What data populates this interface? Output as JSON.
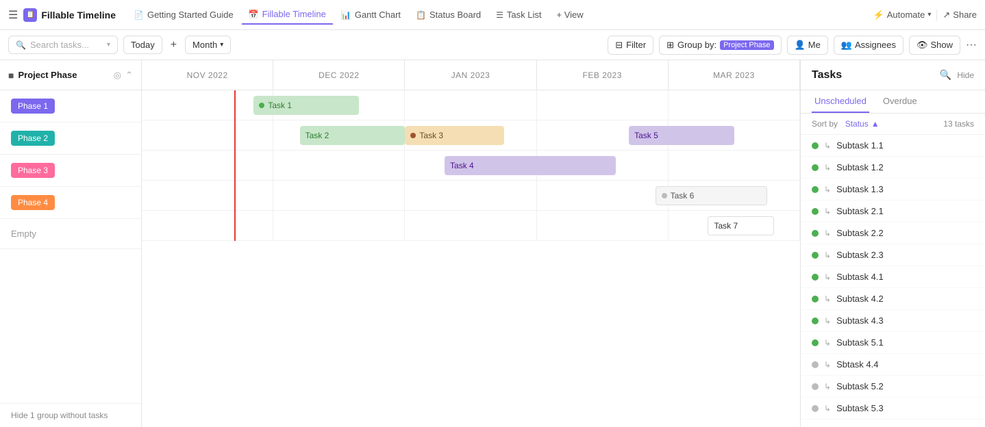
{
  "app": {
    "title": "Fillable Timeline",
    "icon": "📋"
  },
  "nav": {
    "tabs": [
      {
        "id": "getting-started",
        "label": "Getting Started Guide",
        "icon": "📄",
        "active": false
      },
      {
        "id": "fillable-timeline",
        "label": "Fillable Timeline",
        "icon": "📅",
        "active": true
      },
      {
        "id": "gantt-chart",
        "label": "Gantt Chart",
        "icon": "📊",
        "active": false
      },
      {
        "id": "status-board",
        "label": "Status Board",
        "icon": "📋",
        "active": false
      },
      {
        "id": "task-list",
        "label": "Task List",
        "icon": "☰",
        "active": false
      },
      {
        "id": "view",
        "label": "+ View",
        "active": false
      }
    ],
    "automate": "Automate",
    "share": "Share"
  },
  "toolbar": {
    "search_placeholder": "Search tasks...",
    "today": "Today",
    "plus": "+",
    "month": "Month",
    "filter": "Filter",
    "group_by": "Group by:",
    "group_by_tag": "Project Phase",
    "me": "Me",
    "assignees": "Assignees",
    "show": "Show"
  },
  "groups_panel": {
    "title": "Project Phase",
    "phases": [
      {
        "id": "phase1",
        "label": "Phase 1",
        "color": "#7b68ee"
      },
      {
        "id": "phase2",
        "label": "Phase 2",
        "color": "#20b2aa"
      },
      {
        "id": "phase3",
        "label": "Phase 3",
        "color": "#e94f8b"
      },
      {
        "id": "phase4",
        "label": "Phase 4",
        "color": "#ff8c42"
      }
    ],
    "empty_label": "Empty",
    "hide_footer": "Hide 1 group without tasks"
  },
  "timeline": {
    "months": [
      {
        "id": "nov2022",
        "label": "NOV 2022"
      },
      {
        "id": "dec2022",
        "label": "DEC 2022"
      },
      {
        "id": "jan2023",
        "label": "JAN 2023"
      },
      {
        "id": "feb2023",
        "label": "FEB 2023"
      },
      {
        "id": "mar2023",
        "label": "MAR 2023"
      }
    ],
    "tasks": [
      {
        "id": "task1",
        "label": "Task 1",
        "dot_color": "#4caf50",
        "row": 0,
        "bg": "#c8e6c9",
        "text_color": "#2e7d32",
        "left_pct": 17,
        "width_pct": 16
      },
      {
        "id": "task2",
        "label": "Task 2",
        "dot_color": null,
        "row": 1,
        "bg": "#c8e6c9",
        "text_color": "#2e7d32",
        "left_pct": 24,
        "width_pct": 16
      },
      {
        "id": "task3",
        "label": "Task 3",
        "dot_color": "#a0522d",
        "row": 1,
        "bg": "#f5deb3",
        "text_color": "#6b4c1e",
        "left_pct": 40,
        "width_pct": 15
      },
      {
        "id": "task5",
        "label": "Task 5",
        "dot_color": null,
        "row": 1,
        "bg": "#d1c4e9",
        "text_color": "#4a148c",
        "left_pct": 74,
        "width_pct": 16
      },
      {
        "id": "task4",
        "label": "Task 4",
        "dot_color": null,
        "row": 2,
        "bg": "#d1c4e9",
        "text_color": "#4a148c",
        "left_pct": 46,
        "width_pct": 26
      },
      {
        "id": "task6",
        "label": "Task 6",
        "dot_color": "#bbb",
        "row": 3,
        "bg": "#f5f5f5",
        "text_color": "#555",
        "left_pct": 78,
        "width_pct": 17
      },
      {
        "id": "task7",
        "label": "Task 7",
        "dot_color": null,
        "row": 4,
        "bg": "#fff",
        "text_color": "#333",
        "left_pct": 85,
        "width_pct": 10,
        "border": "1px solid #ddd"
      }
    ]
  },
  "tasks_panel": {
    "title": "Tasks",
    "tab_unscheduled": "Unscheduled",
    "tab_overdue": "Overdue",
    "sort_label": "Sort by",
    "sort_value": "Status",
    "tasks_count": "13 tasks",
    "subtasks": [
      {
        "id": "st1",
        "name": "Subtask 1.1",
        "status": "green"
      },
      {
        "id": "st2",
        "name": "Subtask 1.2",
        "status": "green"
      },
      {
        "id": "st3",
        "name": "Subtask 1.3",
        "status": "green"
      },
      {
        "id": "st4",
        "name": "Subtask 2.1",
        "status": "green"
      },
      {
        "id": "st5",
        "name": "Subtask 2.2",
        "status": "green"
      },
      {
        "id": "st6",
        "name": "Subtask 2.3",
        "status": "green"
      },
      {
        "id": "st7",
        "name": "Subtask 4.1",
        "status": "green"
      },
      {
        "id": "st8",
        "name": "Subtask 4.2",
        "status": "green"
      },
      {
        "id": "st9",
        "name": "Subtask 4.3",
        "status": "green"
      },
      {
        "id": "st10",
        "name": "Subtask 5.1",
        "status": "green"
      },
      {
        "id": "st11",
        "name": "Sbtask 4.4",
        "status": "gray"
      },
      {
        "id": "st12",
        "name": "Subtask 5.2",
        "status": "gray"
      },
      {
        "id": "st13",
        "name": "Subtask 5.3",
        "status": "gray"
      }
    ]
  }
}
